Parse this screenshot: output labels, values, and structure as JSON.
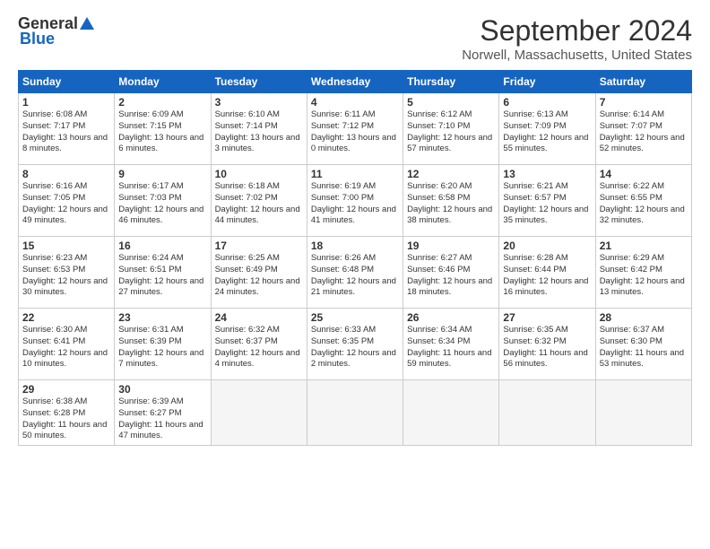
{
  "header": {
    "logo_general": "General",
    "logo_blue": "Blue",
    "title": "September 2024",
    "location": "Norwell, Massachusetts, United States"
  },
  "days_of_week": [
    "Sunday",
    "Monday",
    "Tuesday",
    "Wednesday",
    "Thursday",
    "Friday",
    "Saturday"
  ],
  "weeks": [
    [
      {
        "day": "1",
        "sunrise": "6:08 AM",
        "sunset": "7:17 PM",
        "daylight": "13 hours and 8 minutes."
      },
      {
        "day": "2",
        "sunrise": "6:09 AM",
        "sunset": "7:15 PM",
        "daylight": "13 hours and 6 minutes."
      },
      {
        "day": "3",
        "sunrise": "6:10 AM",
        "sunset": "7:14 PM",
        "daylight": "13 hours and 3 minutes."
      },
      {
        "day": "4",
        "sunrise": "6:11 AM",
        "sunset": "7:12 PM",
        "daylight": "13 hours and 0 minutes."
      },
      {
        "day": "5",
        "sunrise": "6:12 AM",
        "sunset": "7:10 PM",
        "daylight": "12 hours and 57 minutes."
      },
      {
        "day": "6",
        "sunrise": "6:13 AM",
        "sunset": "7:09 PM",
        "daylight": "12 hours and 55 minutes."
      },
      {
        "day": "7",
        "sunrise": "6:14 AM",
        "sunset": "7:07 PM",
        "daylight": "12 hours and 52 minutes."
      }
    ],
    [
      {
        "day": "8",
        "sunrise": "6:16 AM",
        "sunset": "7:05 PM",
        "daylight": "12 hours and 49 minutes."
      },
      {
        "day": "9",
        "sunrise": "6:17 AM",
        "sunset": "7:03 PM",
        "daylight": "12 hours and 46 minutes."
      },
      {
        "day": "10",
        "sunrise": "6:18 AM",
        "sunset": "7:02 PM",
        "daylight": "12 hours and 44 minutes."
      },
      {
        "day": "11",
        "sunrise": "6:19 AM",
        "sunset": "7:00 PM",
        "daylight": "12 hours and 41 minutes."
      },
      {
        "day": "12",
        "sunrise": "6:20 AM",
        "sunset": "6:58 PM",
        "daylight": "12 hours and 38 minutes."
      },
      {
        "day": "13",
        "sunrise": "6:21 AM",
        "sunset": "6:57 PM",
        "daylight": "12 hours and 35 minutes."
      },
      {
        "day": "14",
        "sunrise": "6:22 AM",
        "sunset": "6:55 PM",
        "daylight": "12 hours and 32 minutes."
      }
    ],
    [
      {
        "day": "15",
        "sunrise": "6:23 AM",
        "sunset": "6:53 PM",
        "daylight": "12 hours and 30 minutes."
      },
      {
        "day": "16",
        "sunrise": "6:24 AM",
        "sunset": "6:51 PM",
        "daylight": "12 hours and 27 minutes."
      },
      {
        "day": "17",
        "sunrise": "6:25 AM",
        "sunset": "6:49 PM",
        "daylight": "12 hours and 24 minutes."
      },
      {
        "day": "18",
        "sunrise": "6:26 AM",
        "sunset": "6:48 PM",
        "daylight": "12 hours and 21 minutes."
      },
      {
        "day": "19",
        "sunrise": "6:27 AM",
        "sunset": "6:46 PM",
        "daylight": "12 hours and 18 minutes."
      },
      {
        "day": "20",
        "sunrise": "6:28 AM",
        "sunset": "6:44 PM",
        "daylight": "12 hours and 16 minutes."
      },
      {
        "day": "21",
        "sunrise": "6:29 AM",
        "sunset": "6:42 PM",
        "daylight": "12 hours and 13 minutes."
      }
    ],
    [
      {
        "day": "22",
        "sunrise": "6:30 AM",
        "sunset": "6:41 PM",
        "daylight": "12 hours and 10 minutes."
      },
      {
        "day": "23",
        "sunrise": "6:31 AM",
        "sunset": "6:39 PM",
        "daylight": "12 hours and 7 minutes."
      },
      {
        "day": "24",
        "sunrise": "6:32 AM",
        "sunset": "6:37 PM",
        "daylight": "12 hours and 4 minutes."
      },
      {
        "day": "25",
        "sunrise": "6:33 AM",
        "sunset": "6:35 PM",
        "daylight": "12 hours and 2 minutes."
      },
      {
        "day": "26",
        "sunrise": "6:34 AM",
        "sunset": "6:34 PM",
        "daylight": "11 hours and 59 minutes."
      },
      {
        "day": "27",
        "sunrise": "6:35 AM",
        "sunset": "6:32 PM",
        "daylight": "11 hours and 56 minutes."
      },
      {
        "day": "28",
        "sunrise": "6:37 AM",
        "sunset": "6:30 PM",
        "daylight": "11 hours and 53 minutes."
      }
    ],
    [
      {
        "day": "29",
        "sunrise": "6:38 AM",
        "sunset": "6:28 PM",
        "daylight": "11 hours and 50 minutes."
      },
      {
        "day": "30",
        "sunrise": "6:39 AM",
        "sunset": "6:27 PM",
        "daylight": "11 hours and 47 minutes."
      },
      null,
      null,
      null,
      null,
      null
    ]
  ]
}
